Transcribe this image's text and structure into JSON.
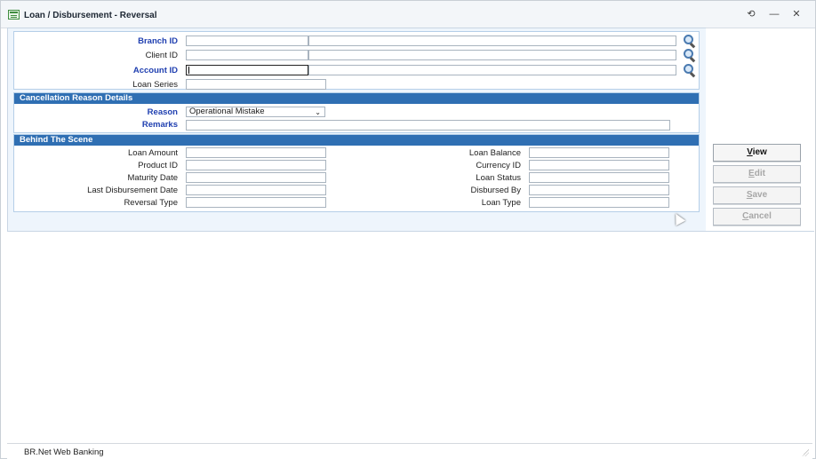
{
  "window": {
    "title": "Loan / Disbursement - Reversal",
    "controls": {
      "refresh": "⟲",
      "minimize": "—",
      "close": "✕"
    }
  },
  "account_panel": {
    "branch_id_label": "Branch ID",
    "client_id_label": "Client ID",
    "account_id_label": "Account ID",
    "loan_series_label": "Loan Series"
  },
  "cancellation": {
    "header": "Cancellation Reason Details",
    "reason_label": "Reason",
    "reason_value": "Operational Mistake",
    "remarks_label": "Remarks"
  },
  "behind_scene": {
    "header": "Behind The Scene",
    "loan_amount_label": "Loan Amount",
    "product_id_label": "Product ID",
    "maturity_date_label": "Maturity Date",
    "last_disbursement_date_label": "Last Disbursement Date",
    "reversal_type_label": "Reversal Type",
    "loan_balance_label": "Loan Balance",
    "currency_id_label": "Currency ID",
    "loan_status_label": "Loan Status",
    "disbursed_by_label": "Disbursed By",
    "loan_type_label": "Loan Type"
  },
  "actions": {
    "view_first": "V",
    "view_rest": "iew",
    "edit_first": "E",
    "edit_rest": "dit",
    "save_first": "S",
    "save_rest": "ave",
    "cancel_first": "C",
    "cancel_rest": "ancel"
  },
  "statusbar": {
    "text": "BR.Net Web Banking"
  },
  "colors": {
    "section_bar": "#2f6fb3",
    "required_label": "#1f3fb0",
    "form_bg": "#eef5fc"
  }
}
